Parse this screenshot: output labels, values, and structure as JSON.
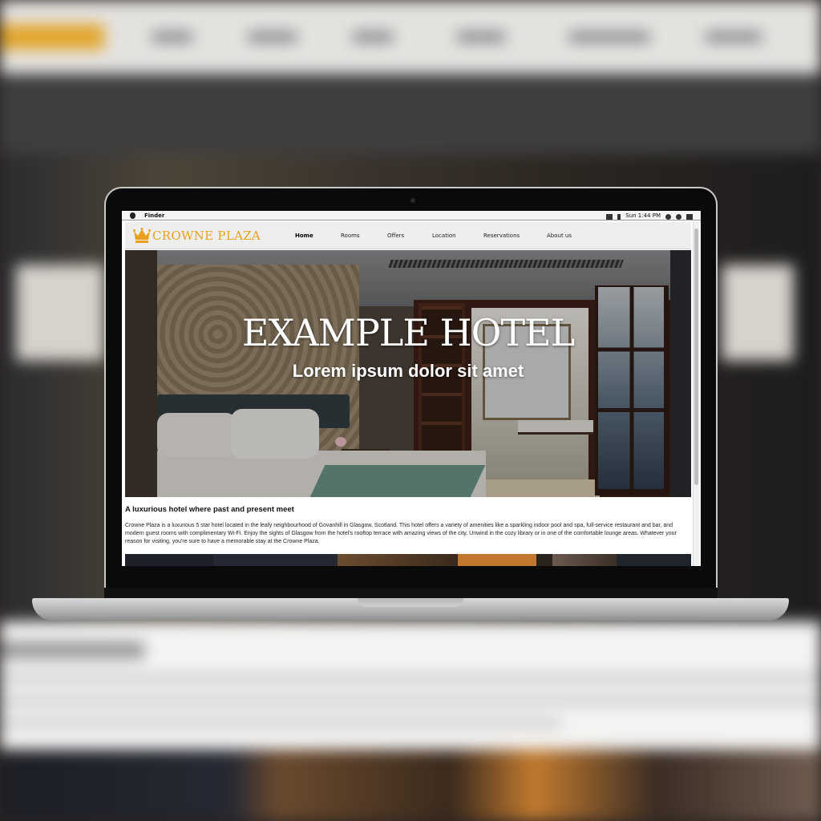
{
  "menubar": {
    "app_name": "Finder",
    "clock": "Sun 1:44 PM"
  },
  "site": {
    "brand": "CROWNE PLAZA",
    "nav": [
      "Home",
      "Rooms",
      "Offers",
      "Location",
      "Reservations",
      "About us"
    ],
    "active_nav": "Home",
    "hero": {
      "title": "EXAMPLE HOTEL",
      "subtitle": "Lorem ipsum dolor sit amet"
    },
    "intro": {
      "heading": "A luxurious hotel where past and present meet",
      "body": "Crowne Plaza is a luxurious 5 star hotel located in the leafy neighbourhood of Govanhill in Glasgow, Scotland. This hotel offers a variety of amenities like a sparkling indoor pool and spa, full-service restaurant and bar, and modern guest rooms with complimentary Wi-Fi. Enjoy the sights of Glasgow from the hotel's rooftop terrace with amazing views of the city. Unwind in the cozy library or in one of the comfortable lounge areas. Whatever your reason for visiting, you're sure to have a memorable stay at the Crowne Plaza."
    }
  },
  "colors": {
    "brand": "#e9a11d",
    "nav_bg": "#eeeeee"
  },
  "icons": [
    "apple-icon",
    "crown-icon",
    "volume-icon",
    "bluetooth-icon",
    "wifi-icon",
    "spotlight-icon",
    "notification-icon"
  ]
}
